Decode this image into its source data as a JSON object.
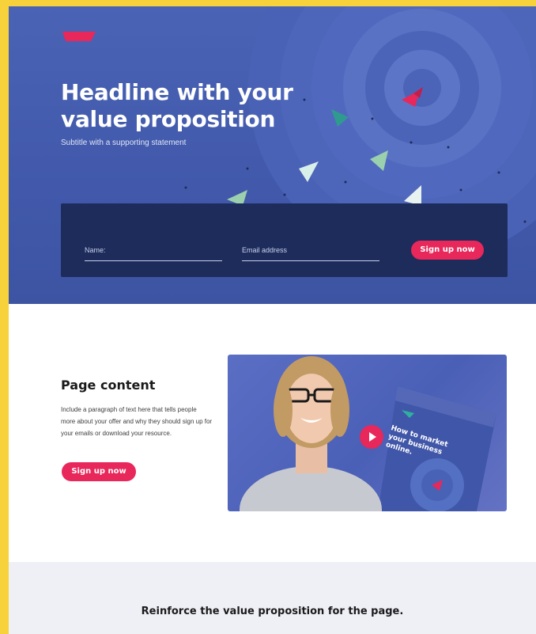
{
  "hero": {
    "headline": "Headline with your value proposition",
    "subtitle": "Subtitle with a supporting statement",
    "brand_color": "#e8275a",
    "background_color": "#4259ab"
  },
  "signup_form": {
    "name_placeholder": "Name:",
    "email_placeholder": "Email address",
    "submit_label": "Sign up now",
    "panel_color": "#1d2c5b"
  },
  "content": {
    "title": "Page content",
    "paragraph": "Include a paragraph of text here that tells people more about your offer and why they should sign up for your emails or download your resource.",
    "cta_label": "Sign up now"
  },
  "video": {
    "book_title": "How to market your business online.",
    "play_icon": "play-icon"
  },
  "footer_section": {
    "text": "Reinforce the value proposition for the page."
  }
}
